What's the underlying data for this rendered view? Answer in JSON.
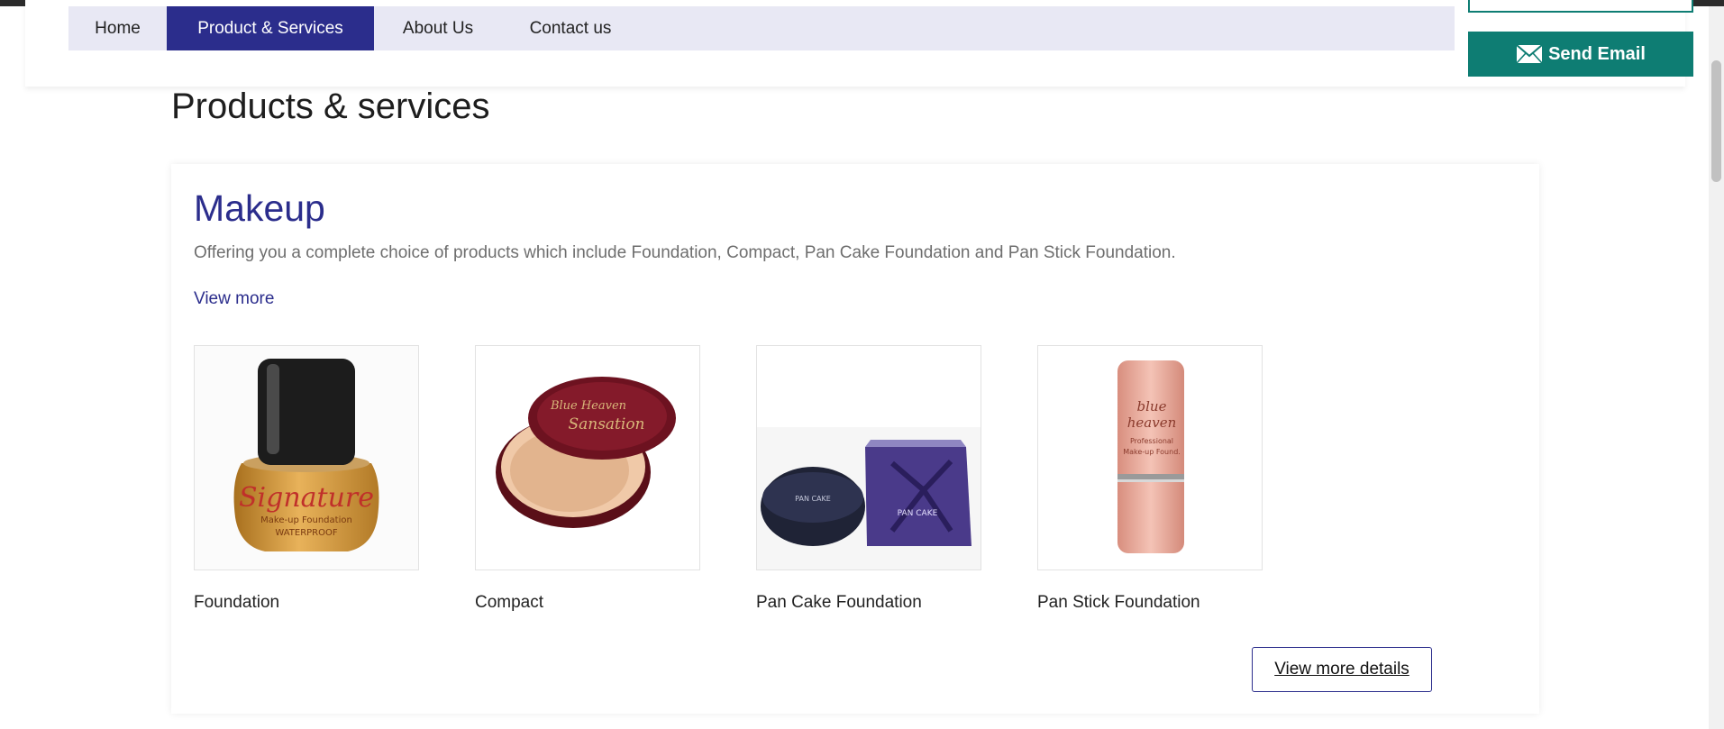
{
  "nav": {
    "items": [
      {
        "label": "Home"
      },
      {
        "label": "Product & Services"
      },
      {
        "label": "About Us"
      },
      {
        "label": "Contact us"
      }
    ]
  },
  "header": {
    "send_email_label": "Send Email"
  },
  "page": {
    "title": "Products & services"
  },
  "section": {
    "title": "Makeup",
    "description": "Offering you a complete choice of products which include Foundation, Compact, Pan Cake Foundation and Pan Stick Foundation.",
    "view_more": "View more",
    "products": [
      {
        "name": "Foundation"
      },
      {
        "name": "Compact"
      },
      {
        "name": "Pan Cake Foundation"
      },
      {
        "name": "Pan Stick Foundation"
      }
    ],
    "details_button": "View more details"
  },
  "colors": {
    "brand_blue": "#2b2d8c",
    "accent_teal": "#0e7d73",
    "nav_background": "#e8e8f4"
  }
}
